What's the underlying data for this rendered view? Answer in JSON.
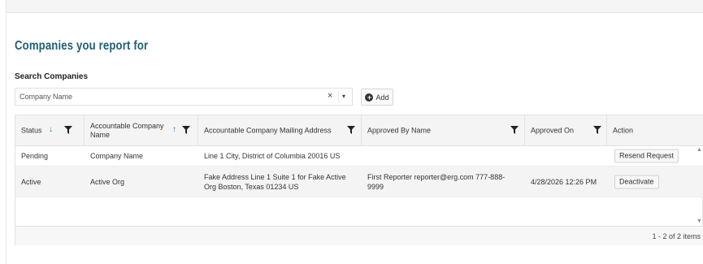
{
  "section": {
    "title": "Companies you report for"
  },
  "search": {
    "label": "Search Companies",
    "value": "Company Name",
    "clear_icon": "×",
    "caret_icon": "▾",
    "add_label": "Add"
  },
  "grid": {
    "columns": [
      {
        "label": "Status"
      },
      {
        "label": "Accountable Company Name"
      },
      {
        "label": "Accountable Company Mailing Address"
      },
      {
        "label": "Approved By Name"
      },
      {
        "label": "Approved On"
      },
      {
        "label": "Action"
      }
    ],
    "sort_down_icon": "↓",
    "sort_up_icon": "↑",
    "rows": [
      {
        "status": "Pending",
        "company": "Company Name",
        "address": "Line 1 City, District of Columbia 20016 US",
        "approved_by": "",
        "approved_on": "",
        "action": "Resend Request"
      },
      {
        "status": "Active",
        "company": "Active Org",
        "address": "Fake Address Line 1 Suite 1 for Fake Active Org Boston, Texas 01234 US",
        "approved_by": "First Reporter reporter@erg.com 777-888-9999",
        "approved_on": "4/28/2026 12:26 PM",
        "action": "Deactivate"
      }
    ],
    "footer": "1 - 2 of 2 items",
    "scroll_up_icon": "▲",
    "scroll_down_icon": "▼"
  },
  "icons": {
    "filter": "funnel-icon",
    "plus": "plus-circle-icon"
  }
}
